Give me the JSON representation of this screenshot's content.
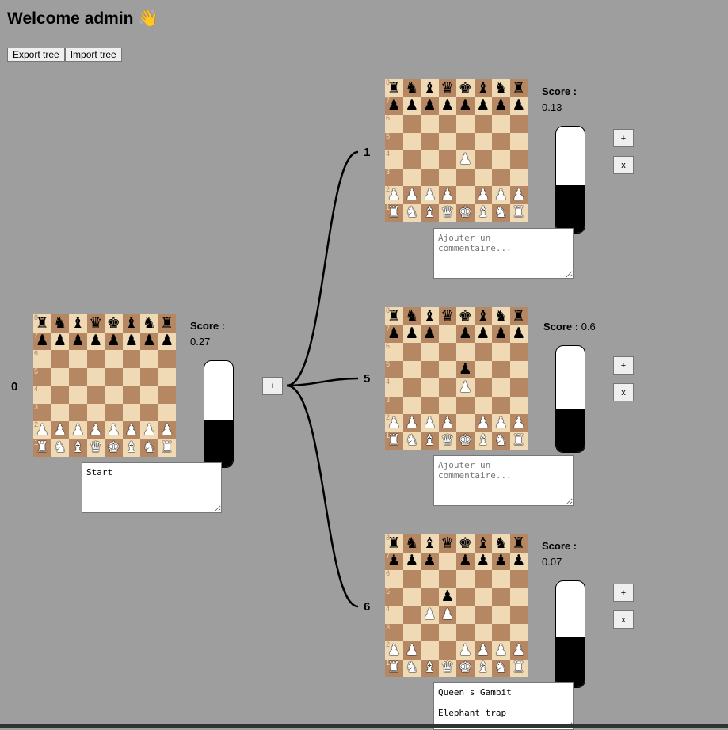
{
  "header": {
    "title": "Welcome admin 👋"
  },
  "toolbar": {
    "export_label": "Export tree",
    "import_label": "Import tree"
  },
  "labels": {
    "score": "Score :",
    "add": "+",
    "remove": "x"
  },
  "pieces": {
    "K": "♚",
    "Q": "♛",
    "R": "♜",
    "B": "♝",
    "N": "♞",
    "P": "♟",
    "k": "♚",
    "q": "♛",
    "r": "♜",
    "b": "♝",
    "n": "♞",
    "p": "♟"
  },
  "colors": {
    "light_square": "#f0d9b5",
    "dark_square": "#b58863",
    "background": "#9e9e9e"
  },
  "nodes": {
    "root": {
      "index": "0",
      "score": "0.27",
      "eval_white_fraction": 0.56,
      "comment": "Start",
      "comment_placeholder": "",
      "board": [
        "rnbqkbnr",
        "pppppppp",
        "........",
        "........",
        "........",
        "........",
        "PPPPPPPP",
        "RNBQKBNR"
      ]
    },
    "child1": {
      "index": "1",
      "score": "0.13",
      "eval_white_fraction": 0.55,
      "comment": "",
      "comment_placeholder": "Ajouter un commentaire...",
      "board": [
        "rnbqkbnr",
        "pppppppp",
        "........",
        "........",
        "....P...",
        "........",
        "PPPP.PPP",
        "RNBQKBNR"
      ]
    },
    "child5": {
      "index": "5",
      "score": "0.6",
      "eval_white_fraction": 0.6,
      "comment": "",
      "comment_placeholder": "Ajouter un commentaire...",
      "board": [
        "rnbqkbnr",
        "ppp.pppp",
        "........",
        "....p...",
        "....P...",
        "........",
        "PPPP.PPP",
        "RNBQKBNR"
      ]
    },
    "child6": {
      "index": "6",
      "score": "0.07",
      "eval_white_fraction": 0.52,
      "comment": "Queen's Gambit\n\nElephant trap",
      "comment_placeholder": "",
      "board": [
        "rnbqkbnr",
        "ppp.pppp",
        "........",
        "...p....",
        "..PP....",
        "........",
        "PP..PPPP",
        "RNBQKBNR"
      ]
    }
  }
}
